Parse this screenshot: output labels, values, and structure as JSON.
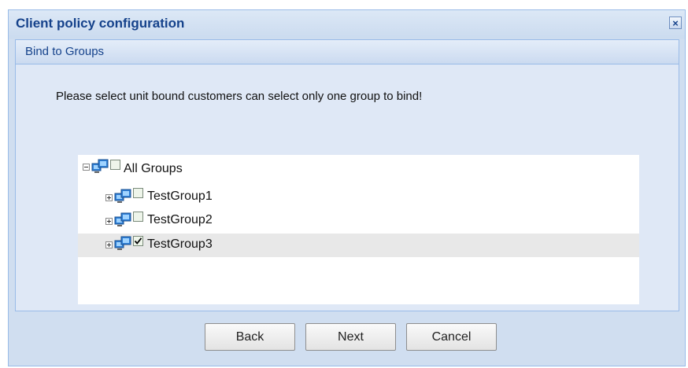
{
  "dialog": {
    "title": "Client policy configuration",
    "close_label": "×"
  },
  "panel": {
    "title": "Bind to Groups",
    "instruction": "Please select unit bound customers can select only one group to bind!"
  },
  "tree": {
    "root": {
      "label": "All Groups",
      "checked": false,
      "expanded": true
    },
    "children": [
      {
        "label": "TestGroup1",
        "checked": false,
        "expanded": false
      },
      {
        "label": "TestGroup2",
        "checked": false,
        "expanded": false
      },
      {
        "label": "TestGroup3",
        "checked": true,
        "expanded": false,
        "selected": true
      }
    ]
  },
  "buttons": {
    "back": "Back",
    "next": "Next",
    "cancel": "Cancel"
  },
  "colors": {
    "title_text": "#15428b",
    "dialog_bg": "#d0def0",
    "panel_bg": "#dfe8f6",
    "border": "#99bbe8"
  }
}
